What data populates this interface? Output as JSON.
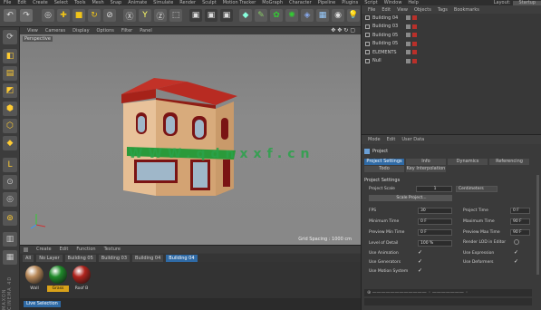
{
  "menubar": {
    "items": [
      "File",
      "Edit",
      "Create",
      "Select",
      "Tools",
      "Mesh",
      "Snap",
      "Animate",
      "Simulate",
      "Render",
      "Sculpt",
      "Motion Tracker",
      "MoGraph",
      "Character",
      "Pipeline",
      "Plugins",
      "Script",
      "Window",
      "Help"
    ],
    "layout_label": "Layout:",
    "layout_value": "Startup"
  },
  "viewport": {
    "menu": [
      "View",
      "Cameras",
      "Display",
      "Options",
      "Filter",
      "Panel"
    ],
    "label": "Perspective",
    "grid_spacing": "Grid Spacing : 1000 cm",
    "watermark": "WWW.qdnxxf.cn"
  },
  "object_manager": {
    "menu": [
      "File",
      "Edit",
      "View",
      "Objects",
      "Tags",
      "Bookmarks"
    ],
    "objects": [
      "Building 04",
      "Building 03",
      "Building 05",
      "Building 05",
      "ELEMENTS",
      "Null"
    ]
  },
  "attribute_manager": {
    "menu": [
      "Mode",
      "Edit",
      "User Data"
    ],
    "title": "Project",
    "tabs": [
      "Project Settings",
      "Info",
      "Dynamics",
      "Referencing",
      "Todo",
      "Key Interpolation"
    ],
    "section": "Project Settings",
    "project_scale_label": "Project Scale",
    "project_scale_value": "1",
    "project_scale_unit": "Centimeters",
    "scale_button": "Scale Project...",
    "fields_left": [
      {
        "label": "FPS",
        "value": "30"
      },
      {
        "label": "Minimum Time",
        "value": "0 F"
      },
      {
        "label": "Preview Min Time",
        "value": "0 F"
      },
      {
        "label": "Level of Detail",
        "value": "100 %"
      }
    ],
    "fields_right": [
      {
        "label": "Project Time",
        "value": "0 F"
      },
      {
        "label": "Maximum Time",
        "value": "90 F"
      },
      {
        "label": "Preview Max Time",
        "value": "90 F"
      }
    ],
    "render_lod_label": "Render LOD in Editor",
    "checks": [
      {
        "label": "Use Animation",
        "checked": true
      },
      {
        "label": "Use Generators",
        "checked": true
      },
      {
        "label": "Use Motion System",
        "checked": true
      }
    ],
    "checks_right": [
      {
        "label": "Use Expression",
        "checked": true
      },
      {
        "label": "Use Deformers",
        "checked": true
      }
    ]
  },
  "material_manager": {
    "menu": [
      "Create",
      "Edit",
      "Function",
      "Texture"
    ],
    "filters": [
      "All",
      "No Layer",
      "Building 05",
      "Building 03",
      "Building 04",
      "Building 04"
    ],
    "materials": [
      {
        "label": "Wall",
        "color": "#b98a5a"
      },
      {
        "label": "Grass",
        "color": "#1f8a2a"
      },
      {
        "label": "Roof B",
        "color": "#b0231c"
      }
    ]
  },
  "status": {
    "tag": "Live Selection"
  },
  "brand": "MAXON CINEMA 4D",
  "colors": {
    "accent": "#2f6aa5",
    "roof": "#b3261e",
    "wall": "#e2b98d",
    "window": "#8a1a1a"
  }
}
